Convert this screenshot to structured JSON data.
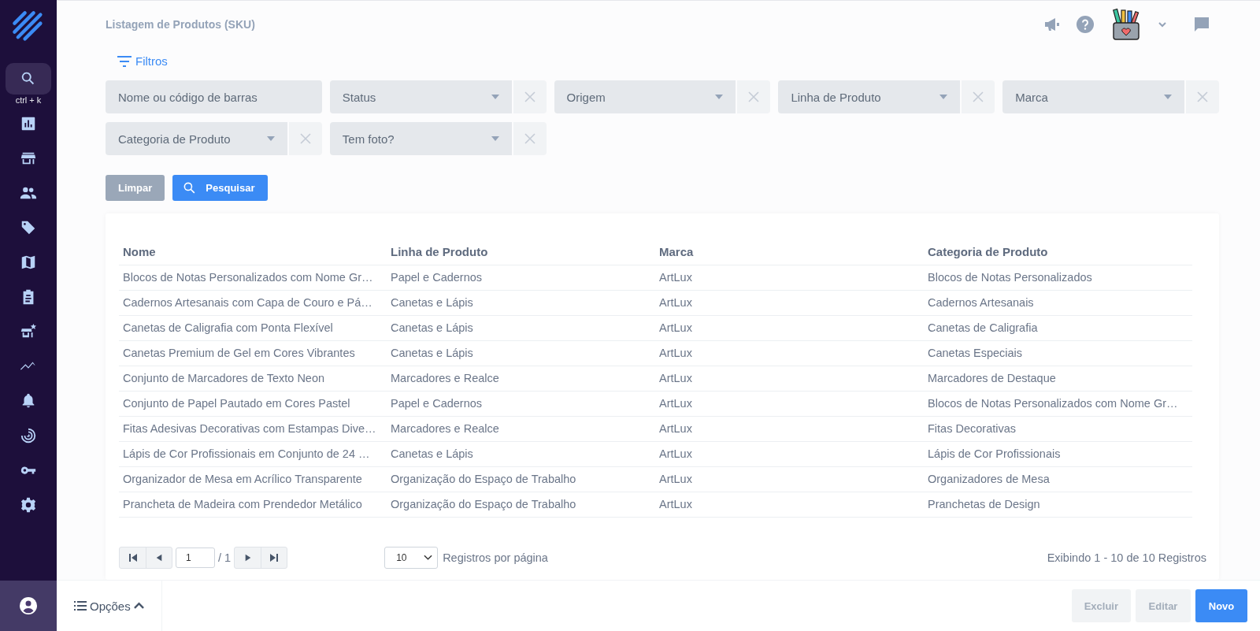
{
  "sidebar": {
    "items": [
      {
        "selected": true,
        "shortcut": "ctrl + k"
      },
      {
        "selected": false
      },
      {
        "selected": false
      },
      {
        "selected": false
      },
      {
        "selected": false
      },
      {
        "selected": false
      },
      {
        "selected": false
      },
      {
        "selected": false
      },
      {
        "selected": false
      },
      {
        "selected": false
      },
      {
        "selected": false
      },
      {
        "selected": false
      },
      {
        "selected": false
      }
    ]
  },
  "header": {
    "title": "Listagem de Produtos (SKU)"
  },
  "filters": {
    "toggle": "Filtros",
    "fields": [
      {
        "kind": "text",
        "placeholder": "Nome ou código de barras"
      },
      {
        "kind": "select",
        "placeholder": "Status"
      },
      {
        "kind": "select",
        "placeholder": "Origem"
      },
      {
        "kind": "select",
        "placeholder": "Linha de Produto"
      },
      {
        "kind": "select",
        "placeholder": "Marca"
      },
      {
        "kind": "select",
        "placeholder": "Categoria de Produto"
      },
      {
        "kind": "select",
        "placeholder": "Tem foto?"
      }
    ],
    "buttons": [
      {
        "label": "Limpar",
        "kind": "secondary"
      },
      {
        "label": "Pesquisar",
        "kind": "primary"
      }
    ]
  },
  "table": {
    "columns": [
      "Nome",
      "Linha de Produto",
      "Marca",
      "Categoria de Produto"
    ],
    "rows": [
      [
        "Blocos de Notas Personalizados com Nome Gr…",
        "Papel e Cadernos",
        "ArtLux",
        "Blocos de Notas Personalizados"
      ],
      [
        "Cadernos Artesanais com Capa de Couro e Pá…",
        "Canetas e Lápis",
        "ArtLux",
        "Cadernos Artesanais"
      ],
      [
        "Canetas de Caligrafia com Ponta Flexível",
        "Canetas e Lápis",
        "ArtLux",
        "Canetas de Caligrafia"
      ],
      [
        "Canetas Premium de Gel em Cores Vibrantes",
        "Canetas e Lápis",
        "ArtLux",
        "Canetas Especiais"
      ],
      [
        "Conjunto de Marcadores de Texto Neon",
        "Marcadores e Realce",
        "ArtLux",
        "Marcadores de Destaque"
      ],
      [
        "Conjunto de Papel Pautado em Cores Pastel",
        "Papel e Cadernos",
        "ArtLux",
        "Blocos de Notas Personalizados com Nome Gr…"
      ],
      [
        "Fitas Adesivas Decorativas com Estampas Dive…",
        "Marcadores e Realce",
        "ArtLux",
        "Fitas Decorativas"
      ],
      [
        "Lápis de Cor Profissionais em Conjunto de 24 …",
        "Canetas e Lápis",
        "ArtLux",
        "Lápis de Cor Profissionais"
      ],
      [
        "Organizador de Mesa em Acrílico Transparente",
        "Organização do Espaço de Trabalho",
        "ArtLux",
        "Organizadores de Mesa"
      ],
      [
        "Prancheta de Madeira com Prendedor Metálico",
        "Organização do Espaço de Trabalho",
        "ArtLux",
        "Pranchetas de Design"
      ]
    ]
  },
  "pagination": {
    "page": "1",
    "total": "/ 1",
    "page_size": "10",
    "page_size_label": "Registros por página",
    "summary": "Exibindo 1 - 10 de 10 Registros"
  },
  "footer": {
    "options": "Opções",
    "buttons": [
      {
        "label": "Excluir",
        "disabled": true
      },
      {
        "label": "Editar",
        "disabled": true
      },
      {
        "label": "Novo",
        "disabled": false
      }
    ]
  }
}
